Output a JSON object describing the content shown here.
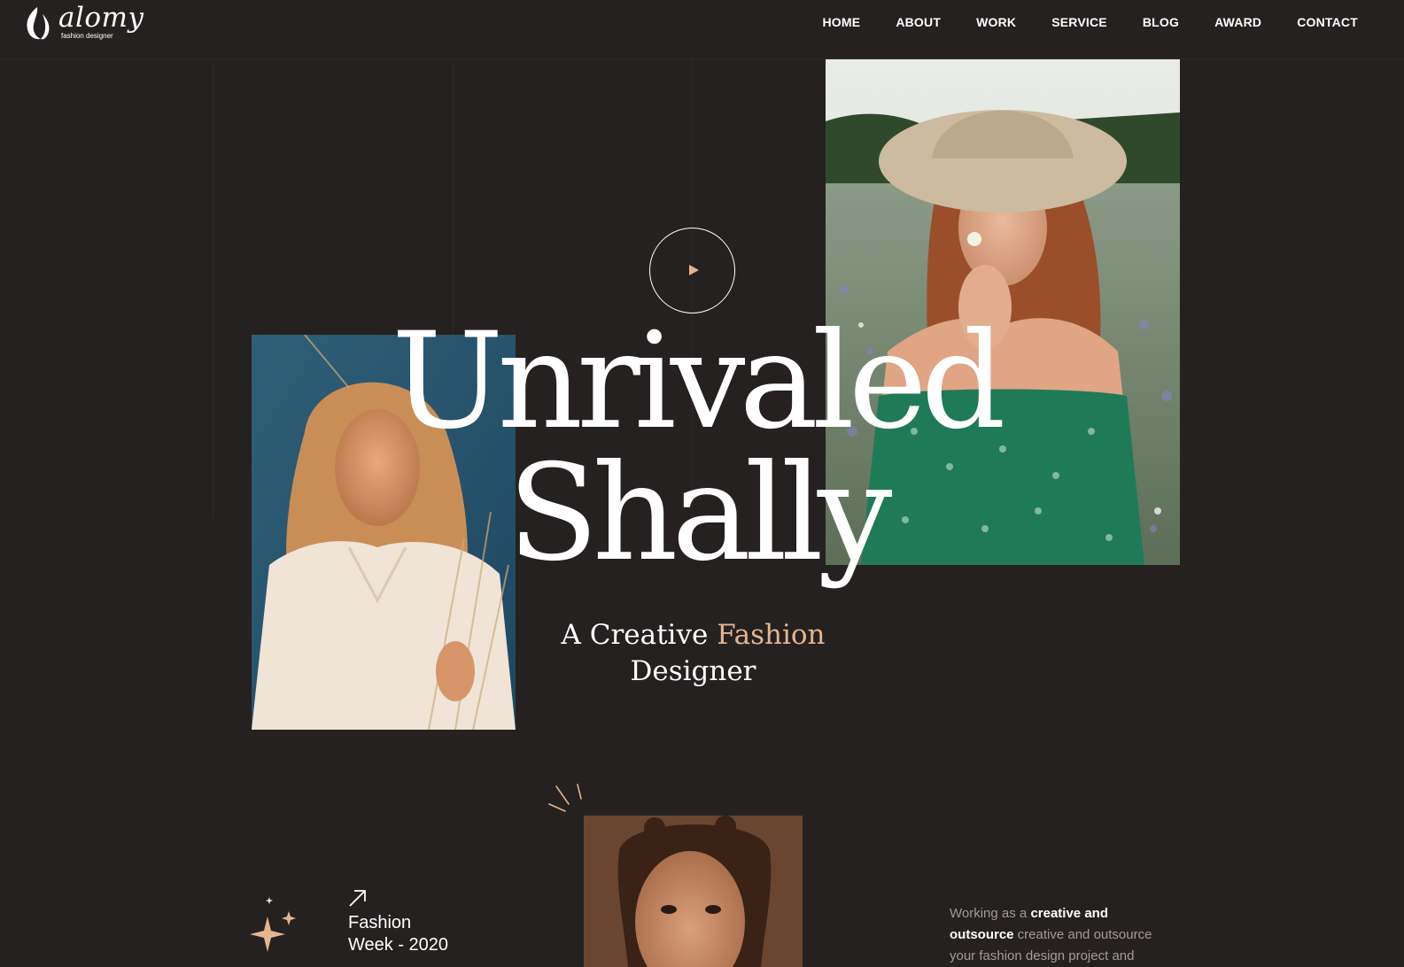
{
  "brand": {
    "name": "alomy",
    "tagline": "fashion designer"
  },
  "nav": {
    "items": [
      {
        "label": "HOME"
      },
      {
        "label": "ABOUT"
      },
      {
        "label": "WORK"
      },
      {
        "label": "SERVICE"
      },
      {
        "label": "BLOG"
      },
      {
        "label": "AWARD"
      },
      {
        "label": "CONTACT"
      }
    ]
  },
  "hero": {
    "line1": "Unrivaled",
    "line2": "Shally",
    "subtitle_part1": "A Creative ",
    "subtitle_accent": "Fashion",
    "subtitle_part2": "Designer",
    "play_icon": "play-icon"
  },
  "event": {
    "line1": "Fashion",
    "line2": "Week - 2020",
    "icon": "arrow-up-right-icon"
  },
  "about": {
    "p1": "Working as a ",
    "b1": "creative and",
    "b2": "outsource",
    "p2": " creative and outsource",
    "p3": "your fashion design project and"
  },
  "colors": {
    "background": "#252120",
    "accent": "#e3b68f",
    "text": "#ffffff",
    "muted_text": "#a49b96"
  }
}
